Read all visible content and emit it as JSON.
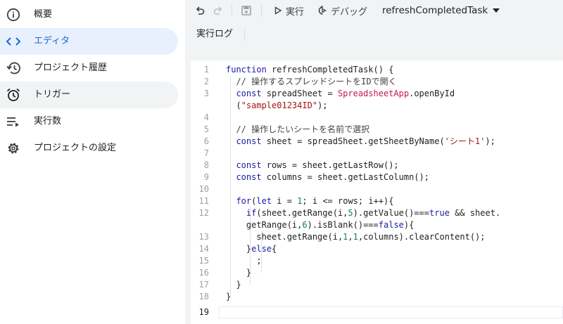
{
  "sidebar": {
    "items": [
      {
        "label": "概要",
        "icon": "info-icon"
      },
      {
        "label": "エディタ",
        "icon": "code-icon"
      },
      {
        "label": "プロジェクト履歴",
        "icon": "history-icon"
      },
      {
        "label": "トリガー",
        "icon": "alarm-icon"
      },
      {
        "label": "実行数",
        "icon": "executions-icon"
      },
      {
        "label": "プロジェクトの設定",
        "icon": "gear-icon"
      }
    ],
    "active_index": 1
  },
  "toolbar": {
    "run_label": "実行",
    "debug_label": "デバッグ",
    "function_select": "refreshCompletedTask",
    "log_label": "実行ログ"
  },
  "colors": {
    "accent": "#1967d2",
    "active_bg": "#e8f0fe",
    "keyword": "#1a1aa6",
    "string": "#a31515",
    "class": "#c2185b",
    "number": "#098658"
  },
  "editor": {
    "lines": [
      {
        "no": "1",
        "text": "function refreshCompletedTask() {"
      },
      {
        "no": "2",
        "text": "  // 操作するスプレッドシートをIDで開く"
      },
      {
        "no": "3",
        "text": "  const spreadSheet = SpreadsheetApp.openById"
      },
      {
        "no": "",
        "text": "  (\"sample01234ID\");"
      },
      {
        "no": "4",
        "text": ""
      },
      {
        "no": "5",
        "text": "  // 操作したいシートを名前で選択"
      },
      {
        "no": "6",
        "text": "  const sheet = spreadSheet.getSheetByName('シート1');"
      },
      {
        "no": "7",
        "text": ""
      },
      {
        "no": "8",
        "text": "  const rows = sheet.getLastRow();"
      },
      {
        "no": "9",
        "text": "  const columns = sheet.getLastColumn();"
      },
      {
        "no": "10",
        "text": ""
      },
      {
        "no": "11",
        "text": "  for(let i = 1; i <= rows; i++){"
      },
      {
        "no": "12",
        "text": "    if(sheet.getRange(i,5).getValue()===true && sheet."
      },
      {
        "no": "",
        "text": "    getRange(i,6).isBlank()===false){"
      },
      {
        "no": "13",
        "text": "      sheet.getRange(i,1,1,columns).clearContent();"
      },
      {
        "no": "14",
        "text": "    }else{"
      },
      {
        "no": "15",
        "text": "      ;"
      },
      {
        "no": "16",
        "text": "    }"
      },
      {
        "no": "17",
        "text": "  }"
      },
      {
        "no": "18",
        "text": "}"
      },
      {
        "no": "19",
        "text": ""
      }
    ]
  }
}
